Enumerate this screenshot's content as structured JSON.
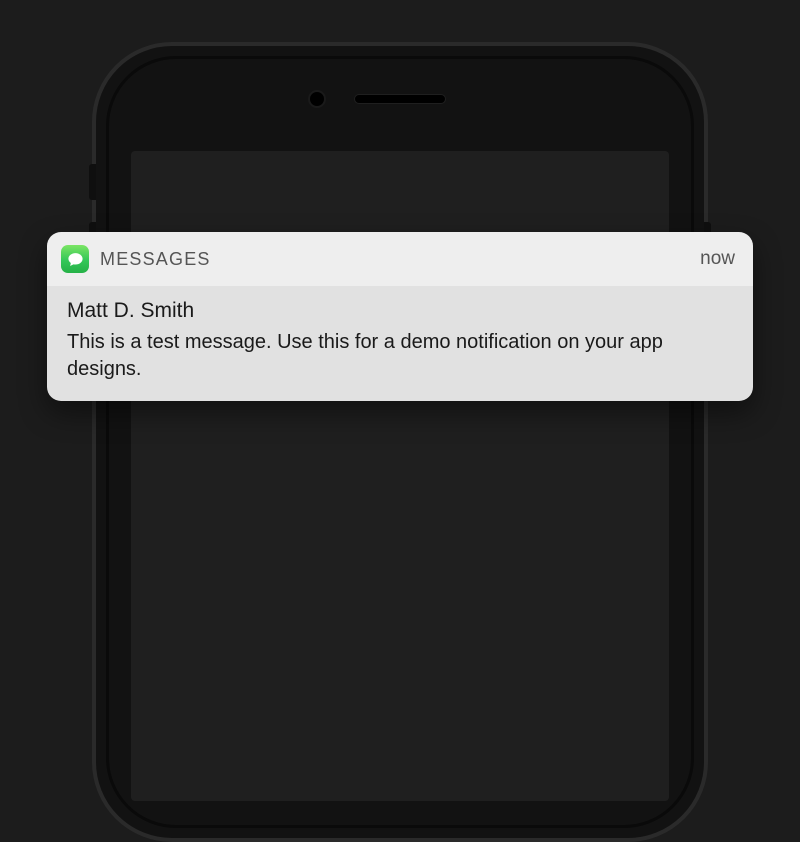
{
  "notification": {
    "app_name": "MESSAGES",
    "timestamp": "now",
    "sender": "Matt D. Smith",
    "message": "This is a test message. Use this for a demo notification on your app designs."
  }
}
